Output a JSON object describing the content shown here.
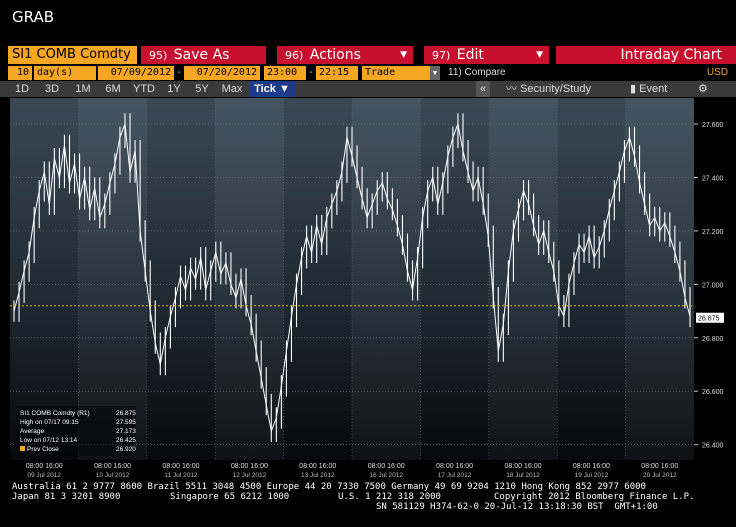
{
  "window": {
    "title": "GRAB"
  },
  "menubar": {
    "ticker": "SI1 COMB Comdty",
    "save_num": "95)",
    "save_label": "Save As",
    "actions_num": "96)",
    "actions_label": "Actions",
    "edit_num": "97)",
    "edit_label": "Edit",
    "chart_title": "Intraday Chart"
  },
  "params": {
    "period_count": "10",
    "period_unit": "day(s)",
    "start_date": "07/09/2012",
    "end_date": "07/20/2012",
    "start_time": "23:00",
    "end_time": "22:15",
    "event": "Trade",
    "compare": "11) Compare",
    "currency": "USD"
  },
  "periods": [
    "1D",
    "3D",
    "1M",
    "6M",
    "YTD",
    "1Y",
    "5Y",
    "Max"
  ],
  "active_period": "Tick",
  "tools": {
    "collapse": "«",
    "security": "Security/Study",
    "event": "Event",
    "settings": "⚙"
  },
  "colors": {
    "orange": "#f5a623",
    "red": "#c8102e",
    "blue": "#1e3a8a"
  },
  "legend": {
    "rows": [
      {
        "label": "SI1 COMB Comdty (R1)",
        "value": "26.875"
      },
      {
        "label": "High on 07/17 09:15",
        "value": "27.595"
      },
      {
        "label": "Average",
        "value": "27.173"
      },
      {
        "label": "Low on 07/12 13:14",
        "value": "26.425"
      },
      {
        "label": "Prev Close",
        "value": "26.920"
      }
    ]
  },
  "chart_data": {
    "type": "line",
    "y_ticks": [
      "26.400",
      "26.600",
      "26.800",
      "27.000",
      "27.200",
      "27.400",
      "27.600"
    ],
    "ylim": [
      26.38,
      27.66
    ],
    "last_value": "26.875",
    "prev_close": 26.92,
    "day_labels": [
      "09 Jul 2012",
      "10 Jul 2012",
      "11 Jul 2012",
      "12 Jul 2012",
      "13 Jul 2012",
      "16 Jul 2012",
      "17 Jul 2012",
      "18 Jul 2012",
      "19 Jul 2012",
      "20 Jul 2012"
    ],
    "time_labels": "08:00 16:00",
    "series": [
      {
        "values": [
          26.9,
          26.97,
          27.05,
          27.12,
          27.25,
          27.35,
          27.42,
          27.3,
          27.47,
          27.4,
          27.52,
          27.38,
          27.45,
          27.32,
          27.4,
          27.28,
          27.36,
          27.25,
          27.3,
          27.38,
          27.45,
          27.55,
          27.6,
          27.42,
          27.5,
          27.2,
          27.05,
          26.9,
          26.78,
          26.7,
          26.8,
          26.88,
          26.95,
          27.03,
          26.98,
          27.06,
          27.02,
          27.1,
          26.98,
          27.05,
          27.12,
          27.04,
          27.08,
          27.0,
          26.95,
          27.02,
          26.92,
          26.85,
          26.75,
          26.65,
          26.55,
          26.45,
          26.5,
          26.62,
          26.75,
          26.88,
          27.0,
          27.1,
          27.18,
          27.12,
          27.22,
          27.15,
          27.25,
          27.3,
          27.35,
          27.42,
          27.55,
          27.48,
          27.4,
          27.32,
          27.25,
          27.3,
          27.35,
          27.38,
          27.32,
          27.28,
          27.22,
          27.15,
          27.05,
          26.98,
          27.1,
          27.25,
          27.35,
          27.4,
          27.3,
          27.38,
          27.48,
          27.55,
          27.6,
          27.5,
          27.42,
          27.35,
          27.4,
          27.3,
          27.18,
          26.95,
          26.75,
          26.85,
          27.05,
          27.2,
          27.28,
          27.35,
          27.3,
          27.22,
          27.15,
          27.2,
          27.12,
          27.05,
          26.92,
          26.88,
          27.0,
          27.08,
          27.15,
          27.12,
          27.18,
          27.1,
          27.14,
          27.2,
          27.28,
          27.35,
          27.42,
          27.5,
          27.55,
          27.48,
          27.38,
          27.3,
          27.22,
          27.25,
          27.2,
          27.23,
          27.18,
          27.12,
          27.05,
          26.95,
          26.88
        ]
      }
    ]
  },
  "footer": {
    "line1": "Australia 61 2 9777 8600 Brazil 5511 3048 4500 Europe 44 20 7330 7500 Germany 49 69 9204 1210 Hong Kong 852 2977 6000",
    "line2a": "Japan 81 3 3201 8900",
    "line2b": "Singapore 65 6212 1000",
    "line2c": "U.S. 1 212 318 2000",
    "line2d": "Copyright 2012 Bloomberg Finance L.P.",
    "line3": "SN 581129 H374-62-0 20-Jul-12 13:18:30 BST  GMT+1:00"
  }
}
